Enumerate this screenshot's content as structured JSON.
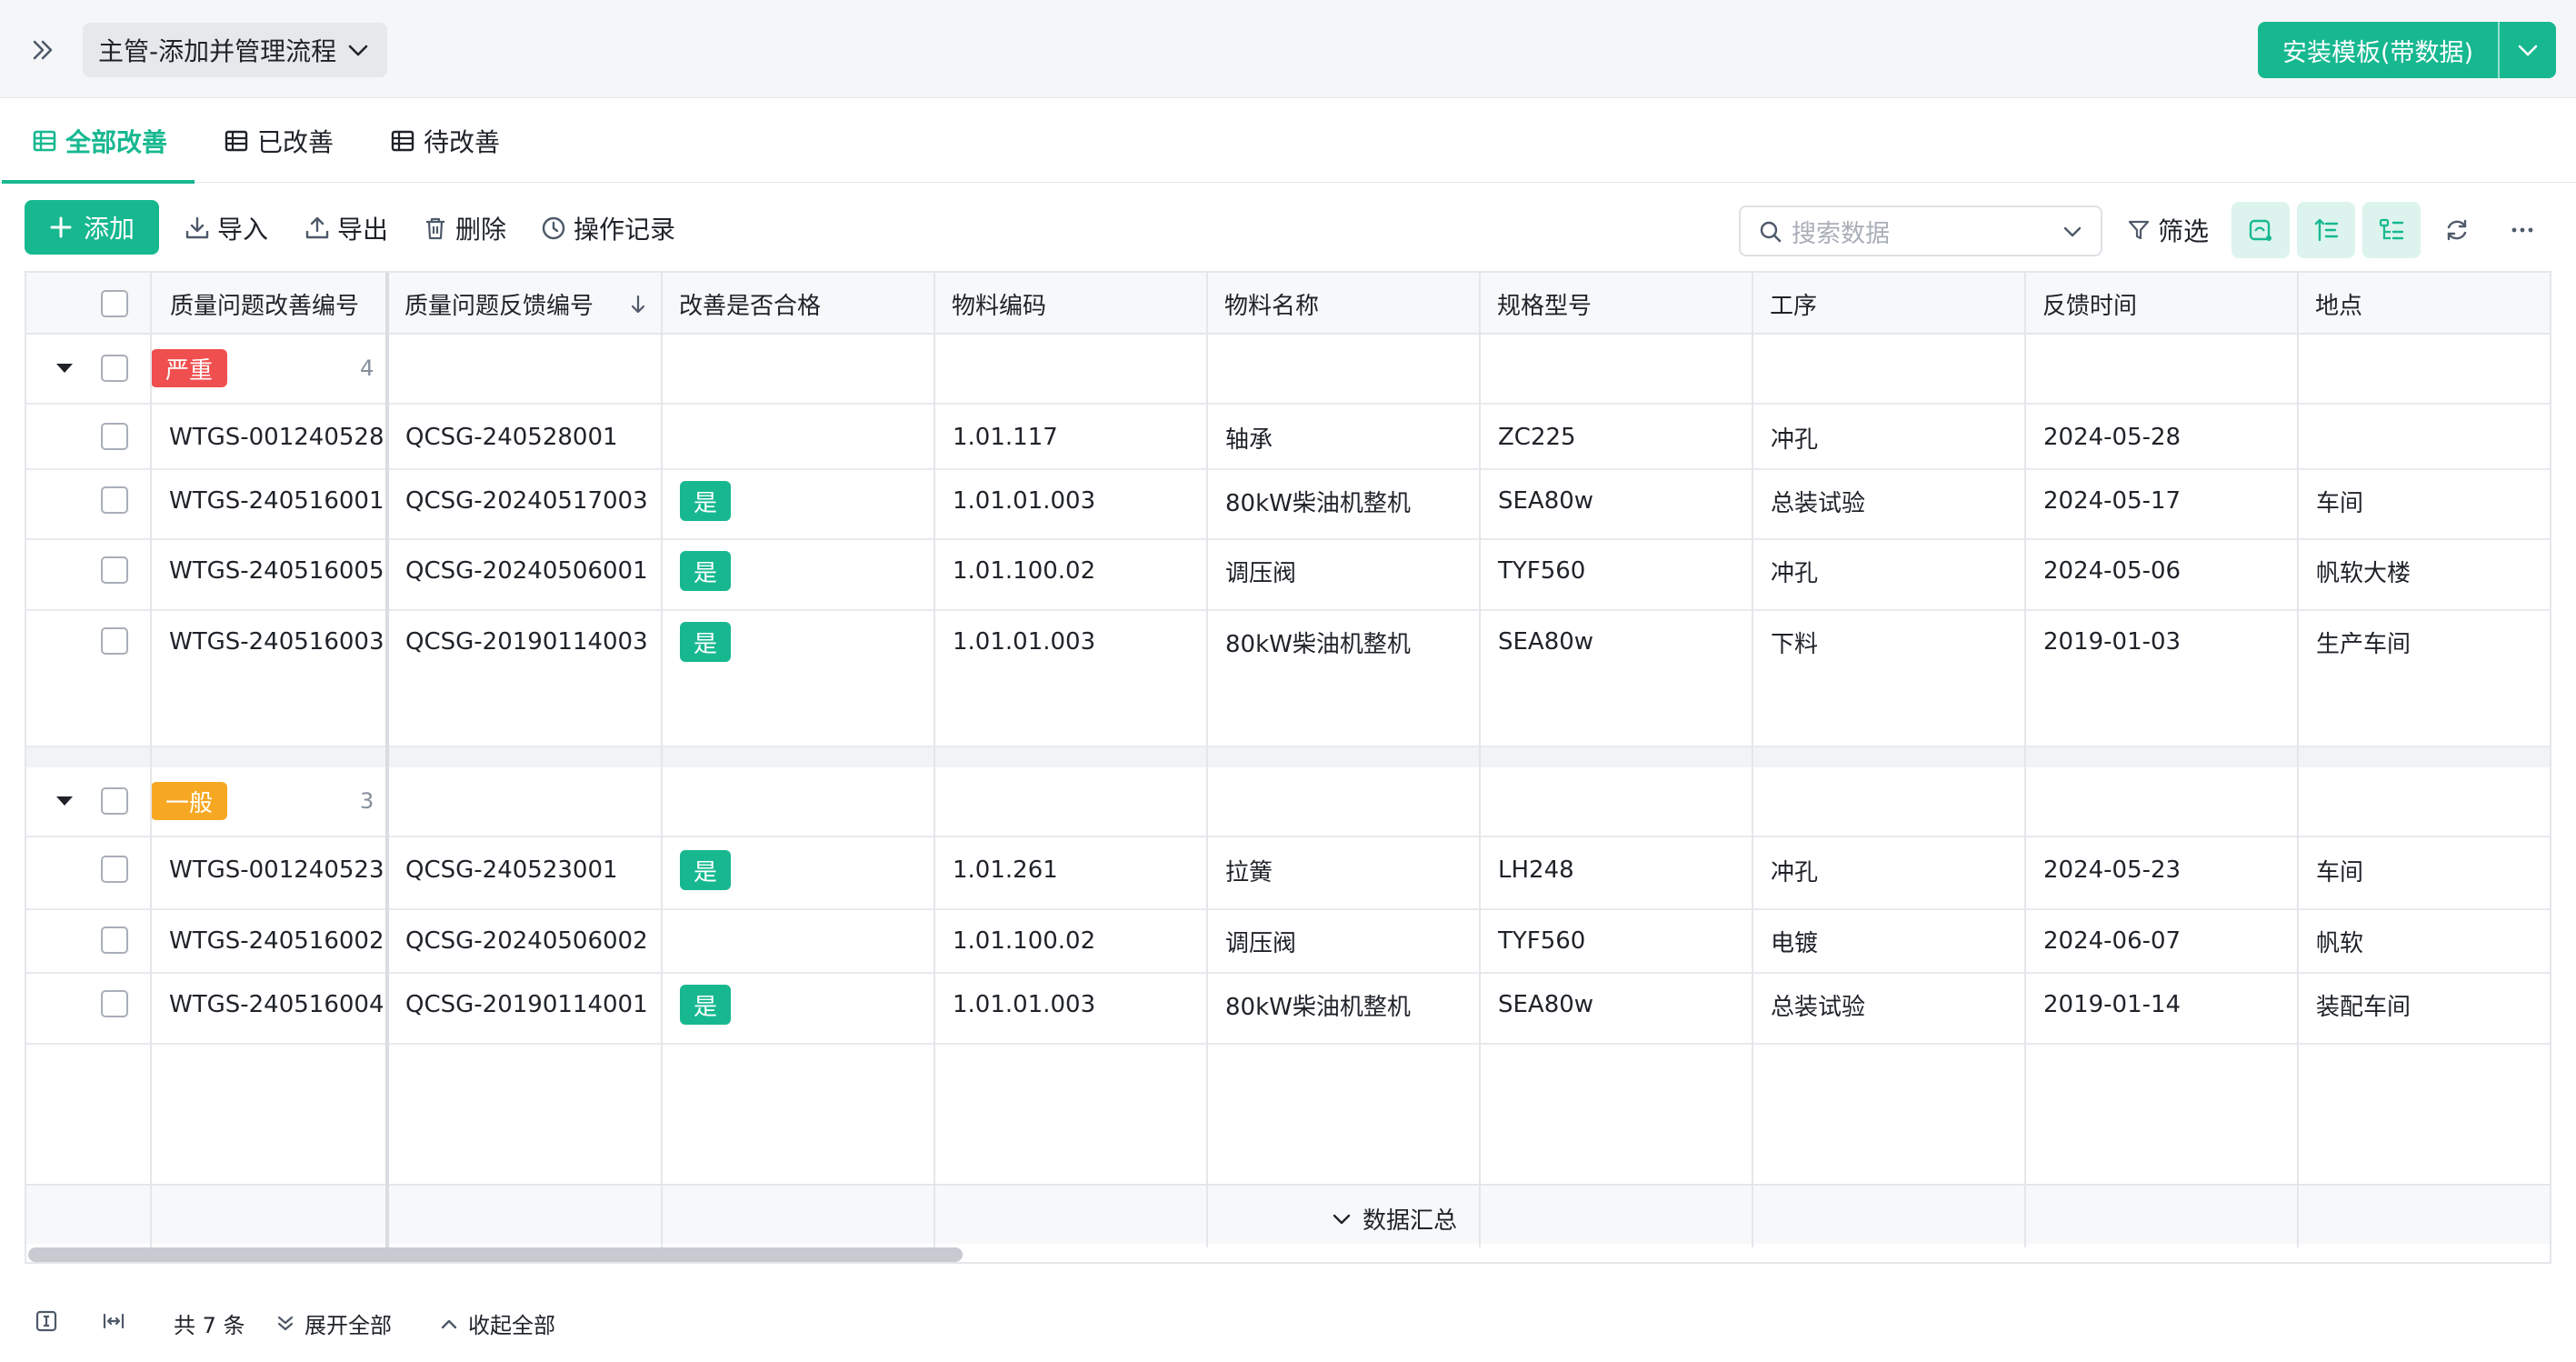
{
  "topbar": {
    "flow_name": "主管-添加并管理流程",
    "install_label": "安装模板(带数据)"
  },
  "tabs": [
    {
      "label": "全部改善",
      "active": true
    },
    {
      "label": "已改善",
      "active": false
    },
    {
      "label": "待改善",
      "active": false
    }
  ],
  "toolbar": {
    "add_label": "添加",
    "import_label": "导入",
    "export_label": "导出",
    "delete_label": "删除",
    "history_label": "操作记录",
    "search_placeholder": "搜索数据",
    "filter_label": "筛选"
  },
  "columns": [
    "质量问题改善编号",
    "质量问题反馈编号",
    "改善是否合格",
    "物料编码",
    "物料名称",
    "规格型号",
    "工序",
    "反馈时间",
    "地点"
  ],
  "groups": [
    {
      "tag": "严重",
      "tag_color": "#f04f4f",
      "count": "4",
      "rows": [
        {
          "id": "WTGS-001240528",
          "feedback": "QCSG-240528001",
          "ok": "",
          "code": "1.01.117",
          "name": "轴承",
          "spec": "ZC225",
          "process": "冲孔",
          "date": "2024-05-28",
          "place": ""
        },
        {
          "id": "WTGS-240516001",
          "feedback": "QCSG-20240517003",
          "ok": "是",
          "code": "1.01.01.003",
          "name": "80kW柴油机整机",
          "spec": "SEA80w",
          "process": "总装试验",
          "date": "2024-05-17",
          "place": "车间"
        },
        {
          "id": "WTGS-240516005",
          "feedback": "QCSG-20240506001",
          "ok": "是",
          "code": "1.01.100.02",
          "name": "调压阀",
          "spec": "TYF560",
          "process": "冲孔",
          "date": "2024-05-06",
          "place": "帆软大楼"
        },
        {
          "id": "WTGS-240516003",
          "feedback": "QCSG-20190114003",
          "ok": "是",
          "code": "1.01.01.003",
          "name": "80kW柴油机整机",
          "spec": "SEA80w",
          "process": "下料",
          "date": "2019-01-03",
          "place": "生产车间"
        }
      ]
    },
    {
      "tag": "一般",
      "tag_color": "#f7a823",
      "count": "3",
      "rows": [
        {
          "id": "WTGS-001240523",
          "feedback": "QCSG-240523001",
          "ok": "是",
          "code": "1.01.261",
          "name": "拉簧",
          "spec": "LH248",
          "process": "冲孔",
          "date": "2024-05-23",
          "place": "车间"
        },
        {
          "id": "WTGS-240516002",
          "feedback": "QCSG-20240506002",
          "ok": "",
          "code": "1.01.100.02",
          "name": "调压阀",
          "spec": "TYF560",
          "process": "电镀",
          "date": "2024-06-07",
          "place": "帆软"
        },
        {
          "id": "WTGS-240516004",
          "feedback": "QCSG-20190114001",
          "ok": "是",
          "code": "1.01.01.003",
          "name": "80kW柴油机整机",
          "spec": "SEA80w",
          "process": "总装试验",
          "date": "2019-01-14",
          "place": "装配车间"
        }
      ]
    }
  ],
  "summary_label": "数据汇总",
  "footer": {
    "total": "共 7 条",
    "expand_all": "展开全部",
    "collapse_all": "收起全部"
  },
  "colors": {
    "accent": "#17b890",
    "danger": "#f04f4f",
    "warning": "#f7a823"
  }
}
